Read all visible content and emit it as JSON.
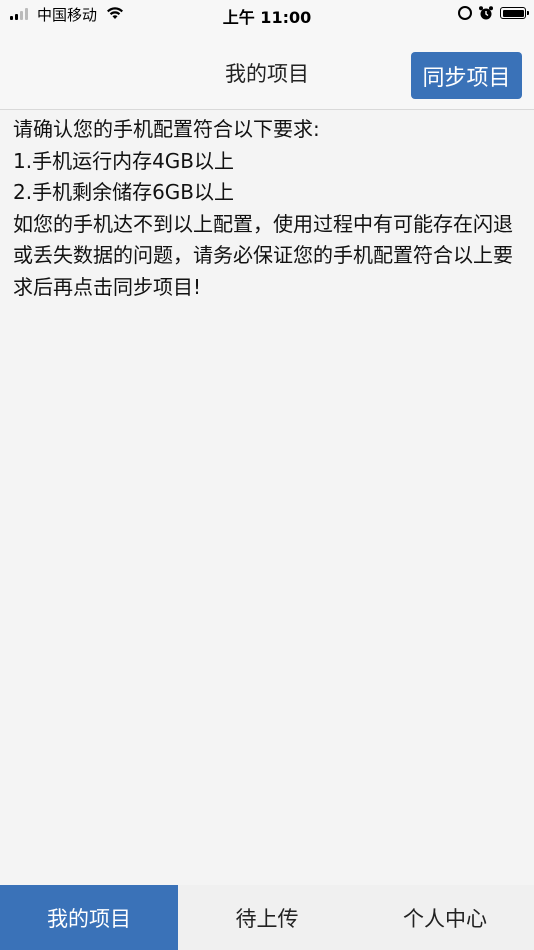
{
  "status_bar": {
    "carrier": "中国移动",
    "time": "上午 11:00"
  },
  "nav": {
    "title": "我的项目",
    "sync_label": "同步项目"
  },
  "content": {
    "lines": [
      "请确认您的手机配置符合以下要求:",
      "1.手机运行内存4GB以上",
      "2.手机剩余储存6GB以上",
      "如您的手机达不到以上配置，使用过程中有可能存在闪退或丢失数据的问题，请务必保证您的手机配置符合以上要求后再点击同步项目!"
    ]
  },
  "tabs": [
    {
      "label": "我的项目",
      "active": true
    },
    {
      "label": "待上传",
      "active": false
    },
    {
      "label": "个人中心",
      "active": false
    }
  ],
  "colors": {
    "accent": "#3a72b8"
  }
}
